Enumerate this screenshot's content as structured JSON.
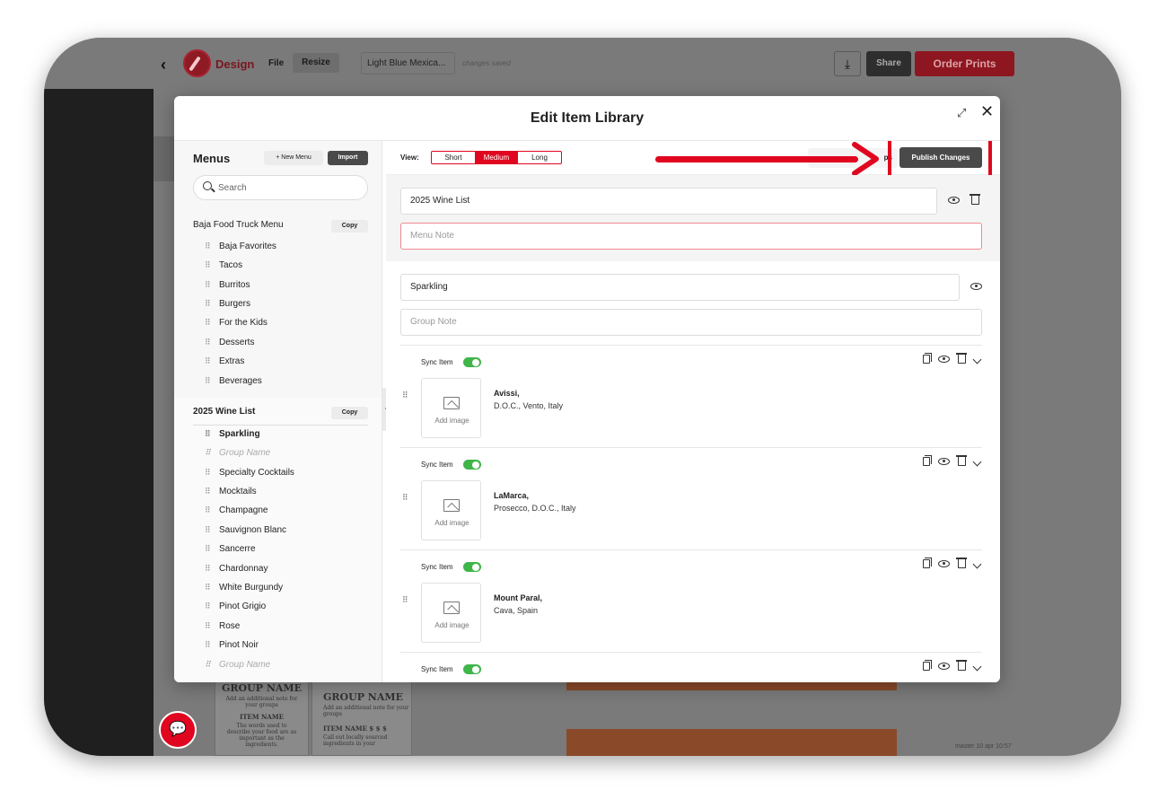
{
  "app": {
    "back_glyph": "‹",
    "design_label": "Design",
    "file_label": "File",
    "resize_label": "Resize",
    "doc_name": "Light Blue Mexica...",
    "save_status": "changes saved",
    "download_glyph": "⤓",
    "share_label": "Share",
    "order_label": "Order Prints",
    "master_info": "master 10 apr 10:57",
    "brand_color": "#e0061f"
  },
  "modal": {
    "title": "Edit Item Library",
    "expand_glyph": "⤢",
    "close_glyph": "✕"
  },
  "sidebar": {
    "title": "Menus",
    "new_menu_label": "+ New Menu",
    "import_label": "Import",
    "search_placeholder": "Search",
    "copy_label": "Copy",
    "menus": [
      {
        "name": "Baja Food Truck Menu",
        "groups": [
          "Baja Favorites",
          "Tacos",
          "Burritos",
          "Burgers",
          "For the Kids",
          "Desserts",
          "Extras",
          "Beverages"
        ]
      },
      {
        "name": "2025 Wine List",
        "groups": [
          "Sparkling",
          "Group Name",
          "Specialty Cocktails",
          "Mocktails",
          "Champagne",
          "Sauvignon Blanc",
          "Sancerre",
          "Chardonnay",
          "White Burgundy",
          "Pinot Grigio",
          "Rose",
          "Pinot Noir",
          "Group Name"
        ]
      }
    ]
  },
  "toolbar": {
    "view_label": "View:",
    "views": [
      "Short",
      "Medium",
      "Long"
    ],
    "active_view": "Medium",
    "ghost_btn_label": "ps",
    "publish_label": "Publish Changes"
  },
  "editor": {
    "menu_name": "2025 Wine List",
    "menu_note_placeholder": "Menu Note",
    "group_name": "Sparkling",
    "group_note_placeholder": "Group Note",
    "sync_label": "Sync Item",
    "add_image_label": "Add image",
    "items": [
      {
        "name": "Avissi,",
        "desc": "D.O.C., Vento, Italy"
      },
      {
        "name": "LaMarca,",
        "desc": "Prosecco, D.O.C., Italy"
      },
      {
        "name": "Mount Paral,",
        "desc": "Cava, Spain"
      },
      {
        "name": "",
        "desc": ""
      }
    ]
  },
  "canvas": {
    "cards": [
      {
        "title": "GROUP NAME",
        "note": "Add an additional note for your groups",
        "item": "ITEM NAME",
        "desc": "The words used to describe your food are as important as the ingredients."
      },
      {
        "title": "GROUP NAME",
        "note": "Add an additional note for your groups",
        "item": "ITEM NAME  $  $  $",
        "desc": "Call out locally sourced ingredients in your"
      }
    ]
  }
}
